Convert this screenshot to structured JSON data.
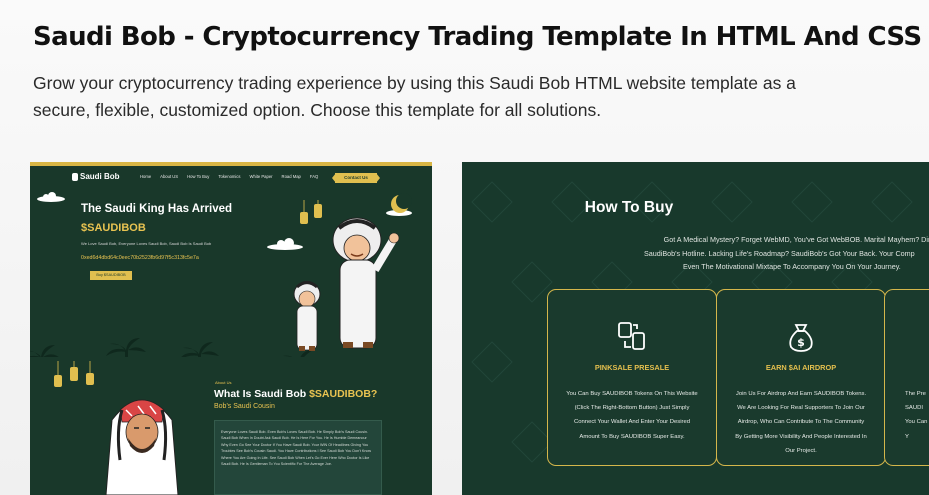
{
  "header": {
    "title": "Saudi Bob - Cryptocurrency Trading Template In HTML And CSS",
    "description": "Grow your cryptocurrency trading experience by using this Saudi Bob HTML website template as a secure, flexible, customized option. Choose this template for all solutions."
  },
  "colors": {
    "dark_green": "#19382a",
    "gold": "#e0bf4f",
    "card_border": "#d4b64b"
  },
  "preview_left": {
    "logo": "Saudi Bob",
    "nav": [
      "Home",
      "About US",
      "How To Buy",
      "Tokenomics",
      "White Paper",
      "Road Map",
      "FAQ"
    ],
    "contact_button": "Contact Us",
    "hero_title": "The Saudi King Has Arrived",
    "ticker": "$SAUDIBOB",
    "hero_line": "We Love Saudi Bob, Everyone Loves Saudi Bob, Saudi Bob Is Saudi Bob",
    "contract_address": "0xed6d4dbd64c0eec70b2523fb6d97f5c313fc5e7a",
    "buy_button": "Buy $SAUDIBOB",
    "about_label": "About Us",
    "about_title_1": "What Is Saudi Bob ",
    "about_title_2": "$SAUDIBOB?",
    "about_subtitle": "Bob's Saudi Cousin",
    "about_text": "Everyone Loves Saudi Bob. Even Bob's Loves Saudi Bob. He Simply Bob's Saudi Cousin. Saudi Bob When In Doubt Ask Saudi Bob. He Is Here For You. He Is Humble Demeanour Why Even Go See Your Doctor If You Have Saudi Bob. Your WIN Of Headlines Giving You Troubles See Bob's Cousin Saudi. You Have Contributions I See Saudi Bob You Don't Know Where You Are Going In Life. See Saudi Bob When Let's Go Ever Here Who Doctor Is Like Saudi Bob. He Is Gentleman To You Scientific For The Average Joe."
  },
  "preview_right": {
    "title": "How To Buy",
    "intro_lines": [
      "Got A Medical Mystery? Forget WebMD, You've Got WebBOB. Marital Mayhem? Dire",
      "SaudiBob's Hotline. Lacking Life's Roadmap? SaudiBob's Got Your Back. Your Comp",
      "Even The Motivational Mixtape To Accompany You On Your Journey."
    ],
    "cards": [
      {
        "icon": "exchange-devices-icon",
        "title": "PINKSALE PRESALE",
        "lines": [
          "You Can Buy SAUDIBOB Tokens On This Website",
          "(Click The Right-Bottom Button) Just Simply",
          "Connect Your Wallet And Enter Your Desired",
          "Amount To Buy SAUDIBOB Super Easy."
        ]
      },
      {
        "icon": "money-bag-icon",
        "title": "EARN $AI AIRDROP",
        "lines": [
          "Join Us For Airdrop And Earn SAUDIBOB Tokens.",
          "We Are Looking For Real Supporters To Join Our",
          "Airdrop, Who Can Contribute To The Community",
          "By Getting More Visibility And People Interested In",
          "Our Project."
        ]
      },
      {
        "icon": "card-icon",
        "title": "",
        "lines": [
          "The Pre",
          "SAUDI",
          "You Can Bu",
          "Y"
        ]
      }
    ]
  }
}
